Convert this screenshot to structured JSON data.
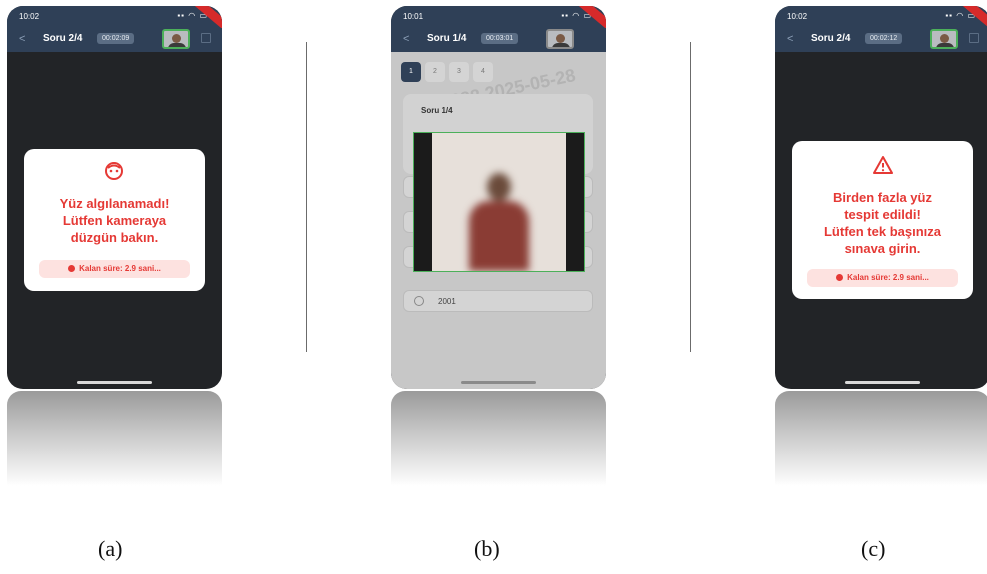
{
  "panels": [
    {
      "id": "a",
      "status_time": "10:02",
      "question_title": "Soru 2/4",
      "timer": "00:02:09",
      "dialog_icon": "face-icon",
      "message_lines": [
        "Yüz algılanamadı!",
        "Lütfen kameraya",
        "düzgün bakın."
      ],
      "countdown": "Kalan süre: 2.9 sani...",
      "caption": "(a)"
    },
    {
      "id": "b",
      "status_time": "10:01",
      "question_title": "Soru 1/4",
      "timer": "00:03:01",
      "question_numbers": [
        "1",
        "2",
        "3",
        "4"
      ],
      "active_question": "1",
      "watermark": "ID: 3688  2025-05-28",
      "question_label": "Soru 1/4",
      "visible_option": "2001",
      "caption": "(b)"
    },
    {
      "id": "c",
      "status_time": "10:02",
      "question_title": "Soru 2/4",
      "timer": "00:02:12",
      "dialog_icon": "warning-icon",
      "message_lines": [
        "Birden fazla yüz",
        "tespit edildi!",
        "Lütfen tek başınıza",
        "sınava girin."
      ],
      "countdown": "Kalan süre: 2.9 sani...",
      "caption": "(c)"
    }
  ],
  "colors": {
    "header": "#2f4057",
    "alert_red": "#e53935",
    "alert_bg": "#fde2e0",
    "camera_border": "#4cb05a"
  }
}
